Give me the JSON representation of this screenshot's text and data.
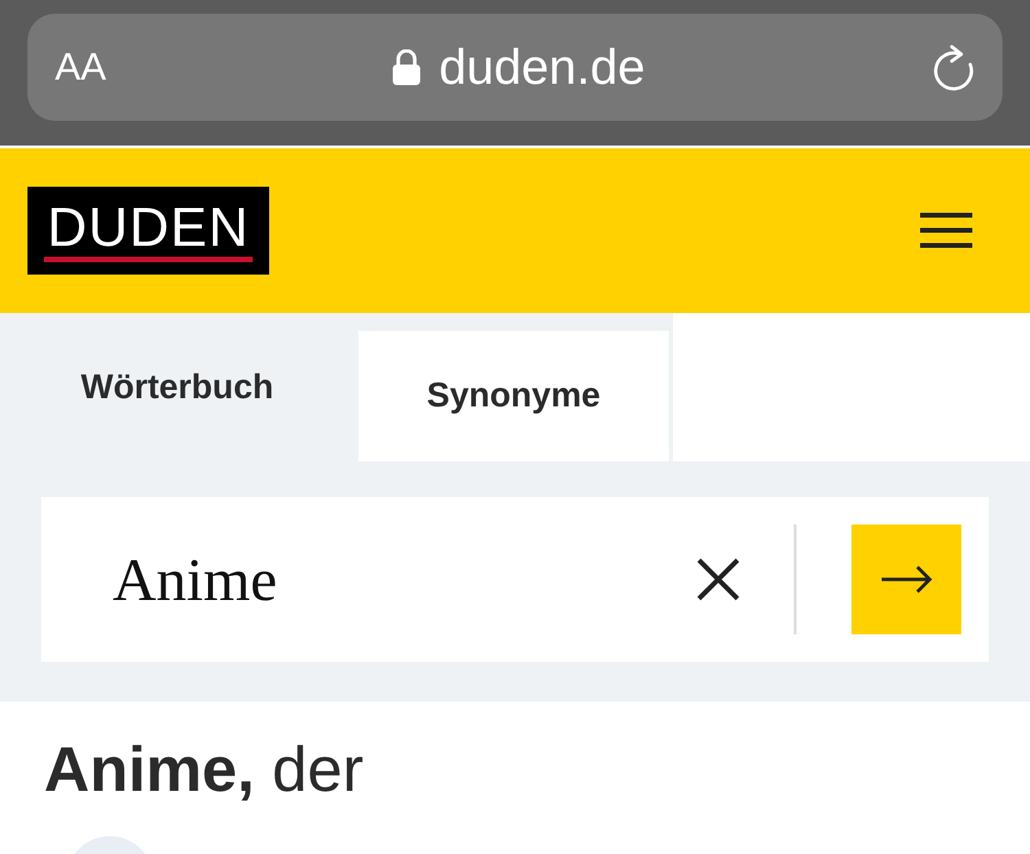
{
  "browser": {
    "text_size_label": "AA",
    "url": "duden.de"
  },
  "header": {
    "logo": "DUDEN"
  },
  "tabs": [
    {
      "label": "Wörterbuch",
      "selected": false
    },
    {
      "label": "Synonyme",
      "selected": true
    }
  ],
  "search": {
    "value": "Anime"
  },
  "entry": {
    "headword": "**Anime,** der"
  }
}
